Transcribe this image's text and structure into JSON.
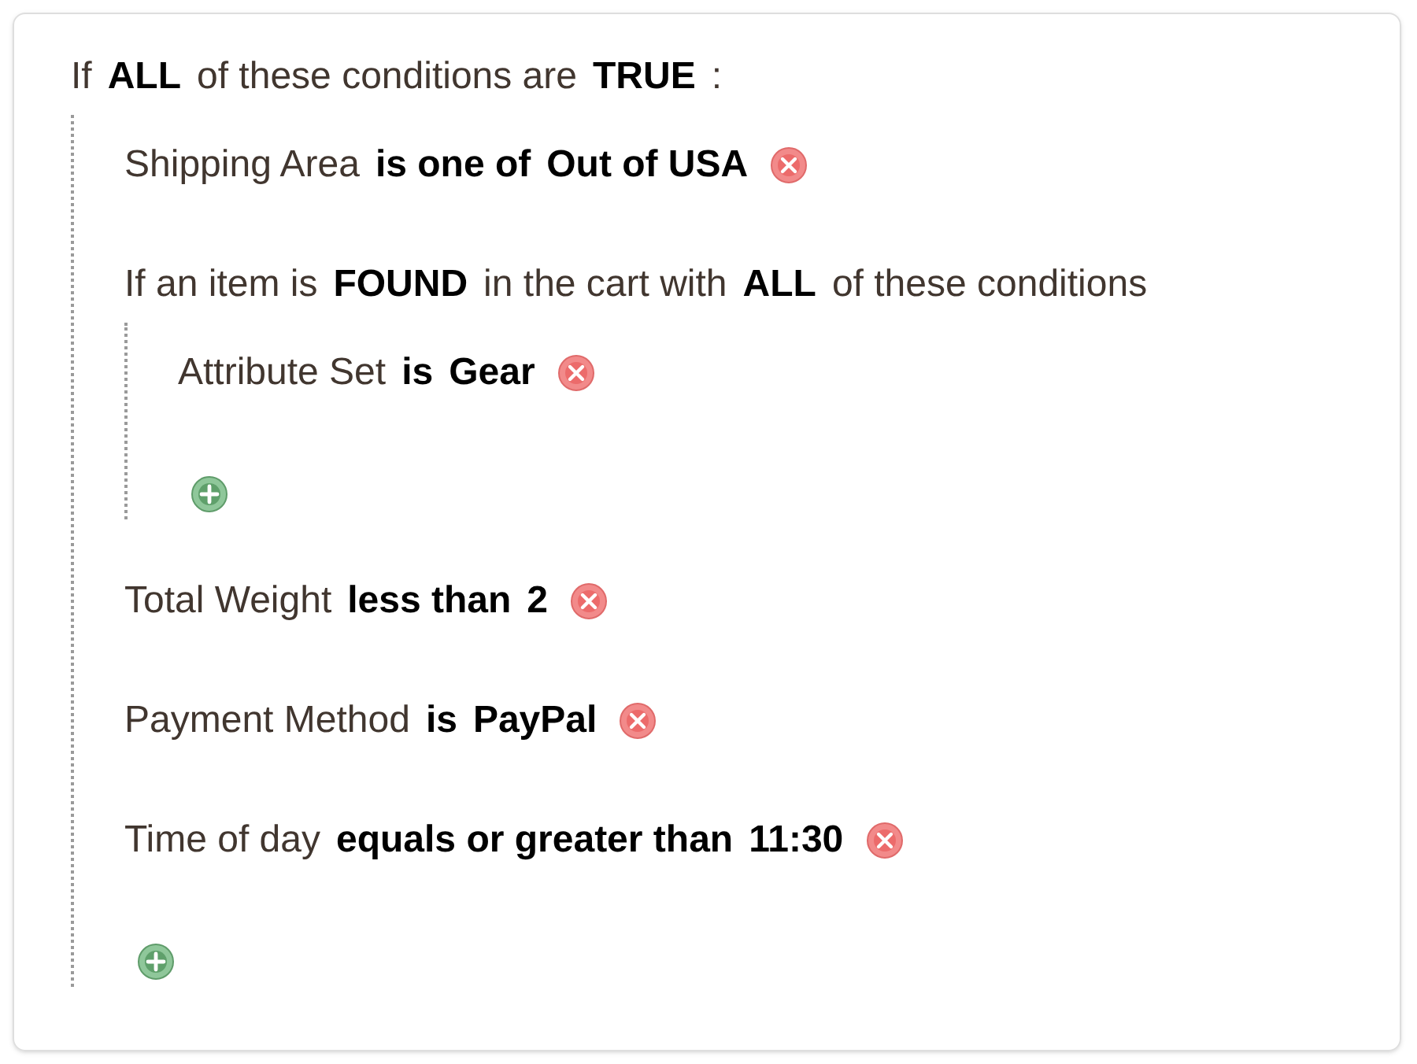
{
  "root": {
    "parts": [
      {
        "text": "If",
        "bold": false
      },
      {
        "text": "ALL",
        "bold": true
      },
      {
        "text": "of these conditions are",
        "bold": false
      },
      {
        "text": "TRUE",
        "bold": true
      },
      {
        "text": ":",
        "bold": false
      }
    ],
    "children": [
      {
        "kind": "condition",
        "parts": [
          {
            "text": "Shipping Area",
            "bold": false
          },
          {
            "text": "is one of",
            "bold": true
          },
          {
            "text": "Out of USA",
            "bold": true
          }
        ]
      },
      {
        "kind": "group",
        "parts": [
          {
            "text": "If an item is",
            "bold": false
          },
          {
            "text": "FOUND",
            "bold": true
          },
          {
            "text": "in the cart with",
            "bold": false
          },
          {
            "text": "ALL",
            "bold": true
          },
          {
            "text": "of these conditions",
            "bold": false
          }
        ],
        "children": [
          {
            "kind": "condition",
            "parts": [
              {
                "text": "Attribute Set",
                "bold": false
              },
              {
                "text": "is",
                "bold": true
              },
              {
                "text": "Gear",
                "bold": true
              }
            ]
          }
        ]
      },
      {
        "kind": "condition",
        "parts": [
          {
            "text": "Total Weight",
            "bold": false
          },
          {
            "text": "less than",
            "bold": true
          },
          {
            "text": "2",
            "bold": true
          }
        ]
      },
      {
        "kind": "condition",
        "parts": [
          {
            "text": "Payment Method",
            "bold": false
          },
          {
            "text": "is",
            "bold": true
          },
          {
            "text": "PayPal",
            "bold": true
          }
        ]
      },
      {
        "kind": "condition",
        "parts": [
          {
            "text": "Time of day",
            "bold": false
          },
          {
            "text": "equals or greater than",
            "bold": true
          },
          {
            "text": "11:30",
            "bold": true
          }
        ]
      }
    ]
  }
}
